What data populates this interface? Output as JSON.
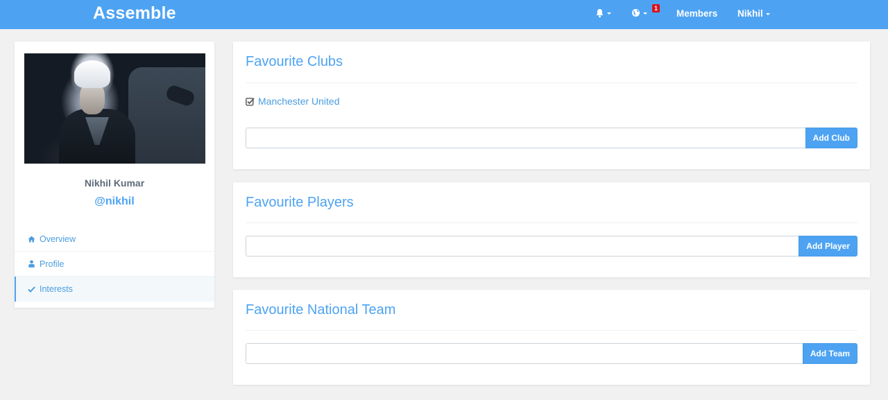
{
  "navbar": {
    "brand": "Assemble",
    "notifications_badge": "1",
    "members_label": "Members",
    "user_label": "Nikhil"
  },
  "sidebar": {
    "name": "Nikhil Kumar",
    "handle": "@nikhil",
    "items": [
      {
        "label": "Overview",
        "icon": "home-icon"
      },
      {
        "label": "Profile",
        "icon": "user-icon"
      },
      {
        "label": "Interests",
        "icon": "check-icon",
        "active": true
      }
    ]
  },
  "panels": {
    "clubs": {
      "title": "Favourite Clubs",
      "items": [
        "Manchester United"
      ],
      "input_value": "",
      "button_label": "Add Club"
    },
    "players": {
      "title": "Favourite Players",
      "input_value": "",
      "button_label": "Add Player"
    },
    "national": {
      "title": "Favourite National Team",
      "input_value": "",
      "button_label": "Add Team"
    }
  },
  "colors": {
    "accent": "#4da3f2",
    "badge": "#d9121b",
    "background": "#f1f1f1"
  }
}
